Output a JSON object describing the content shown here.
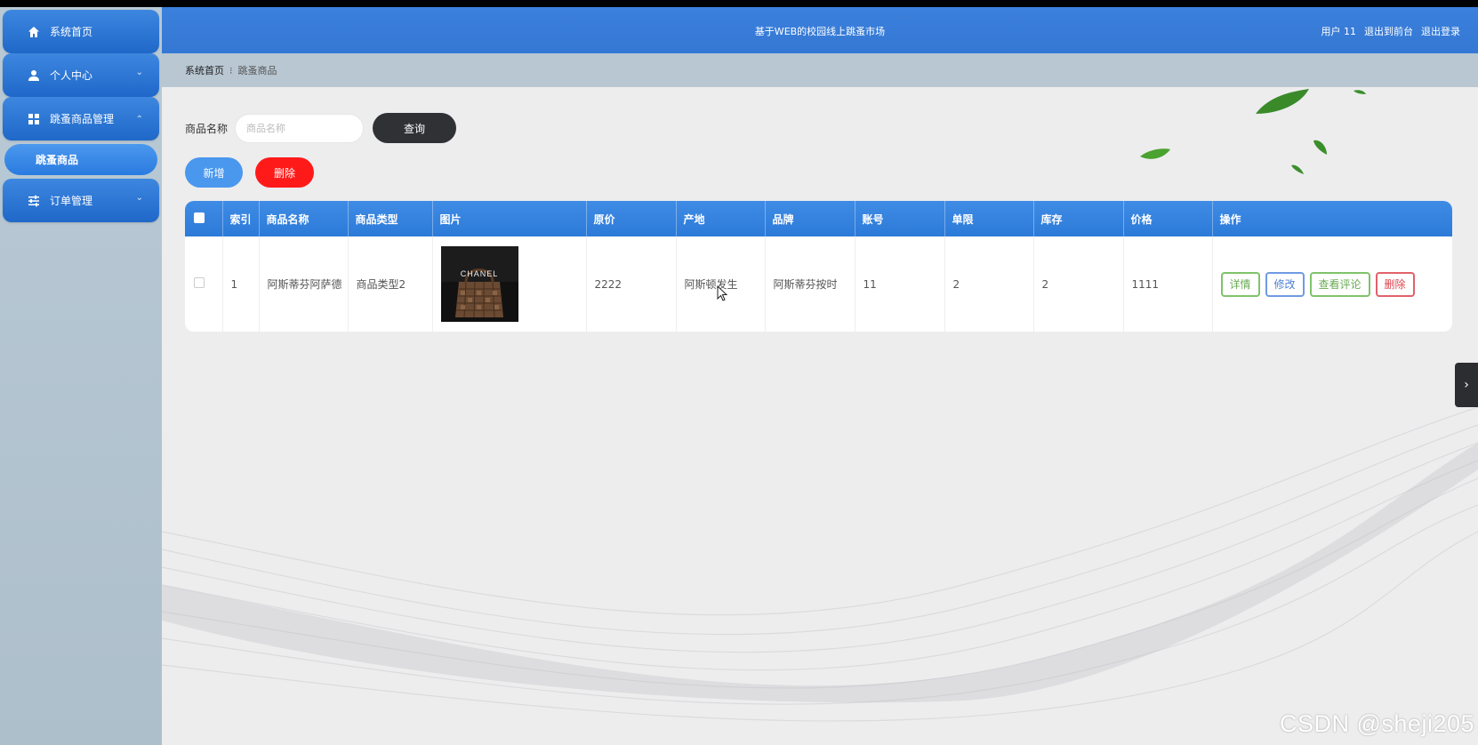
{
  "header": {
    "title": "基于WEB的校园线上跳蚤市场",
    "user_label": "用户 11",
    "back_label": "退出到前台",
    "logout_label": "退出登录"
  },
  "sidebar": {
    "items": [
      {
        "label": "系统首页",
        "icon": "home-icon"
      },
      {
        "label": "个人中心",
        "icon": "user-icon"
      },
      {
        "label": "跳蚤商品管理",
        "icon": "grid-icon"
      },
      {
        "label": "订单管理",
        "icon": "sliders-icon"
      }
    ],
    "submenu": {
      "label": "跳蚤商品"
    }
  },
  "breadcrumb": {
    "home": "系统首页",
    "sep": "⁝",
    "current": "跳蚤商品"
  },
  "search": {
    "label": "商品名称",
    "placeholder": "商品名称",
    "value": "",
    "button": "查询"
  },
  "actions": {
    "add": "新增",
    "delete": "删除"
  },
  "table": {
    "headers": [
      "索引",
      "商品名称",
      "商品类型",
      "图片",
      "原价",
      "产地",
      "品牌",
      "账号",
      "单限",
      "库存",
      "价格",
      "操作"
    ],
    "rows": [
      {
        "index": "1",
        "name": "阿斯蒂芬阿萨德",
        "type": "商品类型2",
        "image": "chanel-handbag",
        "image_text": "CHANEL",
        "original_price": "2222",
        "origin": "阿斯顿发生",
        "brand": "阿斯蒂芬按时",
        "account": "11",
        "limit": "2",
        "stock": "2",
        "price": "1111",
        "ops": {
          "detail": "详情",
          "edit": "修改",
          "review": "查看评论",
          "delete": "删除"
        }
      }
    ]
  },
  "watermark": "CSDN @sheji205",
  "colors": {
    "header": "#3478d4",
    "menu": "#2a74d4",
    "query_button": "#2f3134",
    "add_button": "#4a97ee",
    "delete_button": "#ff1a1a"
  }
}
